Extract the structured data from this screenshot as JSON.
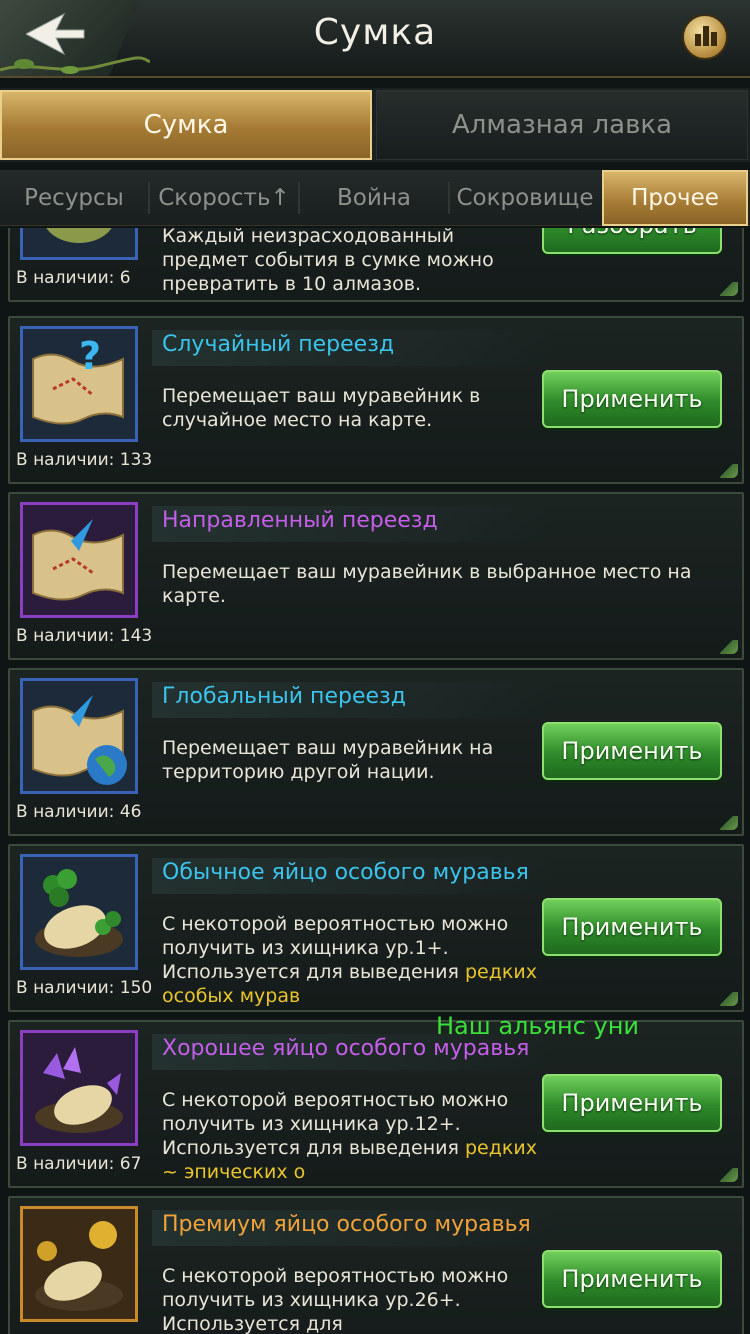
{
  "header": {
    "title": "Сумка",
    "back_icon": "back-arrow-icon",
    "stats_icon": "bar-chart-icon"
  },
  "main_tabs": [
    {
      "label": "Сумка",
      "active": true
    },
    {
      "label": "Алмазная лавка",
      "active": false
    }
  ],
  "sub_tabs": [
    {
      "label": "Ресурсы",
      "active": false
    },
    {
      "label": "Скорость↑",
      "active": false
    },
    {
      "label": "Война",
      "active": false
    },
    {
      "label": "Сокровище",
      "active": false
    },
    {
      "label": "Прочее",
      "active": true
    }
  ],
  "items": [
    {
      "count": "В наличии: 6",
      "name": "",
      "desc": "Каждый неизрасходованный предмет события в сумке можно превратить в 10 алмазов.",
      "button": "Разобрать"
    },
    {
      "count": "В наличии: 133",
      "name": "Случайный переезд",
      "desc": "Перемещает ваш муравейник в случайное место на карте.",
      "button": "Применить"
    },
    {
      "count": "В наличии: 143",
      "name": "Направленный переезд",
      "desc": "Перемещает ваш муравейник в выбранное место на карте.",
      "button": ""
    },
    {
      "count": "В наличии: 46",
      "name": "Глобальный переезд",
      "desc": "Перемещает ваш муравейник на территорию другой нации.",
      "button": "Применить"
    },
    {
      "count": "В наличии: 150",
      "name": "Обычное яйцо особого муравья",
      "desc": "С некоторой вероятностью можно получить из хищника ур.1+. Используется для выведения ",
      "desc_highlight": "редких особых мурав",
      "button": "Применить"
    },
    {
      "count": "В наличии: 67",
      "name": "Хорошее яйцо особого муравья",
      "desc": "С некоторой вероятностью можно получить из хищника ур.12+. Используется для выведения ",
      "desc_highlight": "редких ~ эпических о",
      "button": "Применить"
    },
    {
      "count": "",
      "name": "Премиум яйцо особого муравья",
      "desc": "С некоторой вероятностью можно получить из хищника ур.26+. Используется для",
      "button": "Применить"
    }
  ],
  "chat_overlay": "Наш альянс уни"
}
